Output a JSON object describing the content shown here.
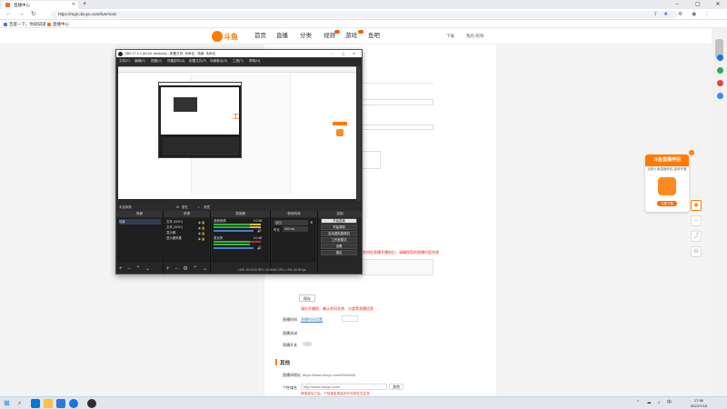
{
  "browser": {
    "tab_title": "直播中心",
    "url": "https://mgs.douyu.com/live/main",
    "bookmarks": [
      "百度一下，你就知道",
      "直播中心"
    ]
  },
  "site": {
    "logo_text": "斗鱼",
    "nav": [
      "首页",
      "直播",
      "分类",
      "视频",
      "游戏",
      "鱼吧"
    ],
    "header_right": [
      "下载",
      "我的·昵称"
    ]
  },
  "form": {
    "label_other": "其他",
    "room_url_label": "直播间地址",
    "room_url": "https://www.douyu.com/9994468",
    "tag_label": "个性域名",
    "tag_value": "http://www.douyu.com/",
    "tag_btn": "其他",
    "note_red": "修改成功之后，个性域名将会在30分钟左右生效",
    "close_label": "直播关闭",
    "time_label": "直播时间",
    "red_line_1": "房间在直播开播前后，请确保您的直播内容合规",
    "red_line_2": "请在开播前，确认房间名称、分类等直播信息"
  },
  "promo": {
    "title": "斗鱼直播伴侣",
    "subtitle": "全新斗鱼直播伴侣 高效开播",
    "download": "立即下载"
  },
  "obs": {
    "title": "OBS 27.2.4 (64-bit, windows) - 配置文件: 未命名 - 场景: 未命名",
    "menu": [
      "文件(F)",
      "编辑(E)",
      "视图(V)",
      "停靠部件(D)",
      "配置文件(P)",
      "场景集合(S)",
      "工具(T)",
      "帮助(H)"
    ],
    "status_left": "未选择源",
    "status_props": "属性",
    "status_filters": "滤镜",
    "docks": {
      "scenes": "场景",
      "sources": "来源",
      "mixer": "混音器",
      "transitions": "转场特效",
      "controls": "控制"
    },
    "scene_items": [
      "场景"
    ],
    "source_items": [
      "文本 (GDI+)",
      "文本 (GDI+)",
      "显示器",
      "显示器采集"
    ],
    "mixer_items": [
      {
        "name": "桌面音频",
        "db": "0.0 dB"
      },
      {
        "name": "麦克风",
        "db": "0.0 dB"
      }
    ],
    "transition": {
      "type": "淡出",
      "duration_label": "时长",
      "duration": "300 ms"
    },
    "controls": [
      "开始直播",
      "开始录制",
      "启动虚拟摄像机",
      "工作室模式",
      "设置",
      "退出"
    ],
    "statusbar": "LIVE: 00:00:00   REC: 00:00:00   CPU: 1.9%, 60.00 fps"
  },
  "taskbar": {
    "time": "17:56",
    "date": "2022/7/18"
  },
  "colors": {
    "accent": "#ff7a00",
    "link": "#3a7fd6",
    "warning": "#e1251b"
  }
}
